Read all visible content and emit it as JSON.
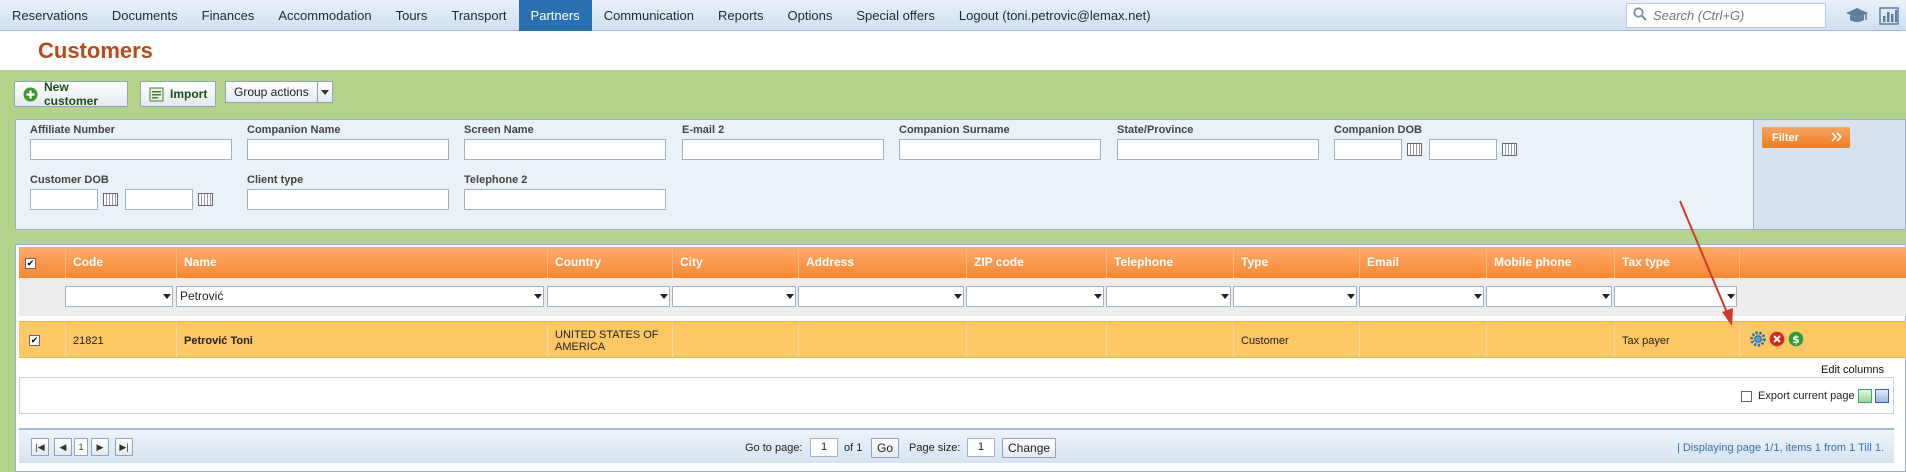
{
  "nav": {
    "items": [
      "Reservations",
      "Documents",
      "Finances",
      "Accommodation",
      "Tours",
      "Transport",
      "Partners",
      "Communication",
      "Reports",
      "Options",
      "Special offers",
      "Logout (toni.petrovic@lemax.net)"
    ],
    "active": "Partners",
    "search_placeholder": "Search (Ctrl+G)",
    "icons": [
      "graduation-cap-icon",
      "bar-chart-icon"
    ]
  },
  "page": {
    "title": "Customers"
  },
  "toolbar": {
    "new_customer": "New customer",
    "import": "Import",
    "group_actions": "Group actions"
  },
  "filters": {
    "affiliate_number": "Affiliate Number",
    "companion_name": "Companion Name",
    "screen_name": "Screen Name",
    "email2": "E-mail 2",
    "companion_surname": "Companion Surname",
    "state_province": "State/Province",
    "companion_dob": "Companion DOB",
    "customer_dob": "Customer DOB",
    "client_type": "Client type",
    "telephone2": "Telephone 2",
    "filter_button": "Filter"
  },
  "grid": {
    "columns": [
      "Code",
      "Name",
      "Country",
      "City",
      "Address",
      "ZIP code",
      "Telephone",
      "Type",
      "Email",
      "Mobile phone",
      "Tax type"
    ],
    "filter_values": {
      "name": "Petrović"
    },
    "rows": [
      {
        "code": "21821",
        "name": "Petrović Toni",
        "country": "UNITED STATES OF AMERICA",
        "city": "",
        "address": "",
        "zip": "",
        "telephone": "",
        "type": "Customer",
        "email": "",
        "mobile": "",
        "tax_type": "Tax payer"
      }
    ],
    "edit_columns": "Edit columns",
    "export_label": "Export current page"
  },
  "pager": {
    "current_page": "1",
    "goto_label": "Go to page:",
    "goto_value": "1",
    "of_label": "of 1",
    "go_button": "Go",
    "page_size_label": "Page size:",
    "page_size_value": "1",
    "change_button": "Change",
    "status": "| Displaying page 1/1, items 1 from 1 Till 1."
  },
  "colors": {
    "accent_blue": "#2b6fb3",
    "header_orange": "#f6882f",
    "band_green": "#b3d38a",
    "selected_row": "#fcc765",
    "title": "#b84a1a"
  }
}
